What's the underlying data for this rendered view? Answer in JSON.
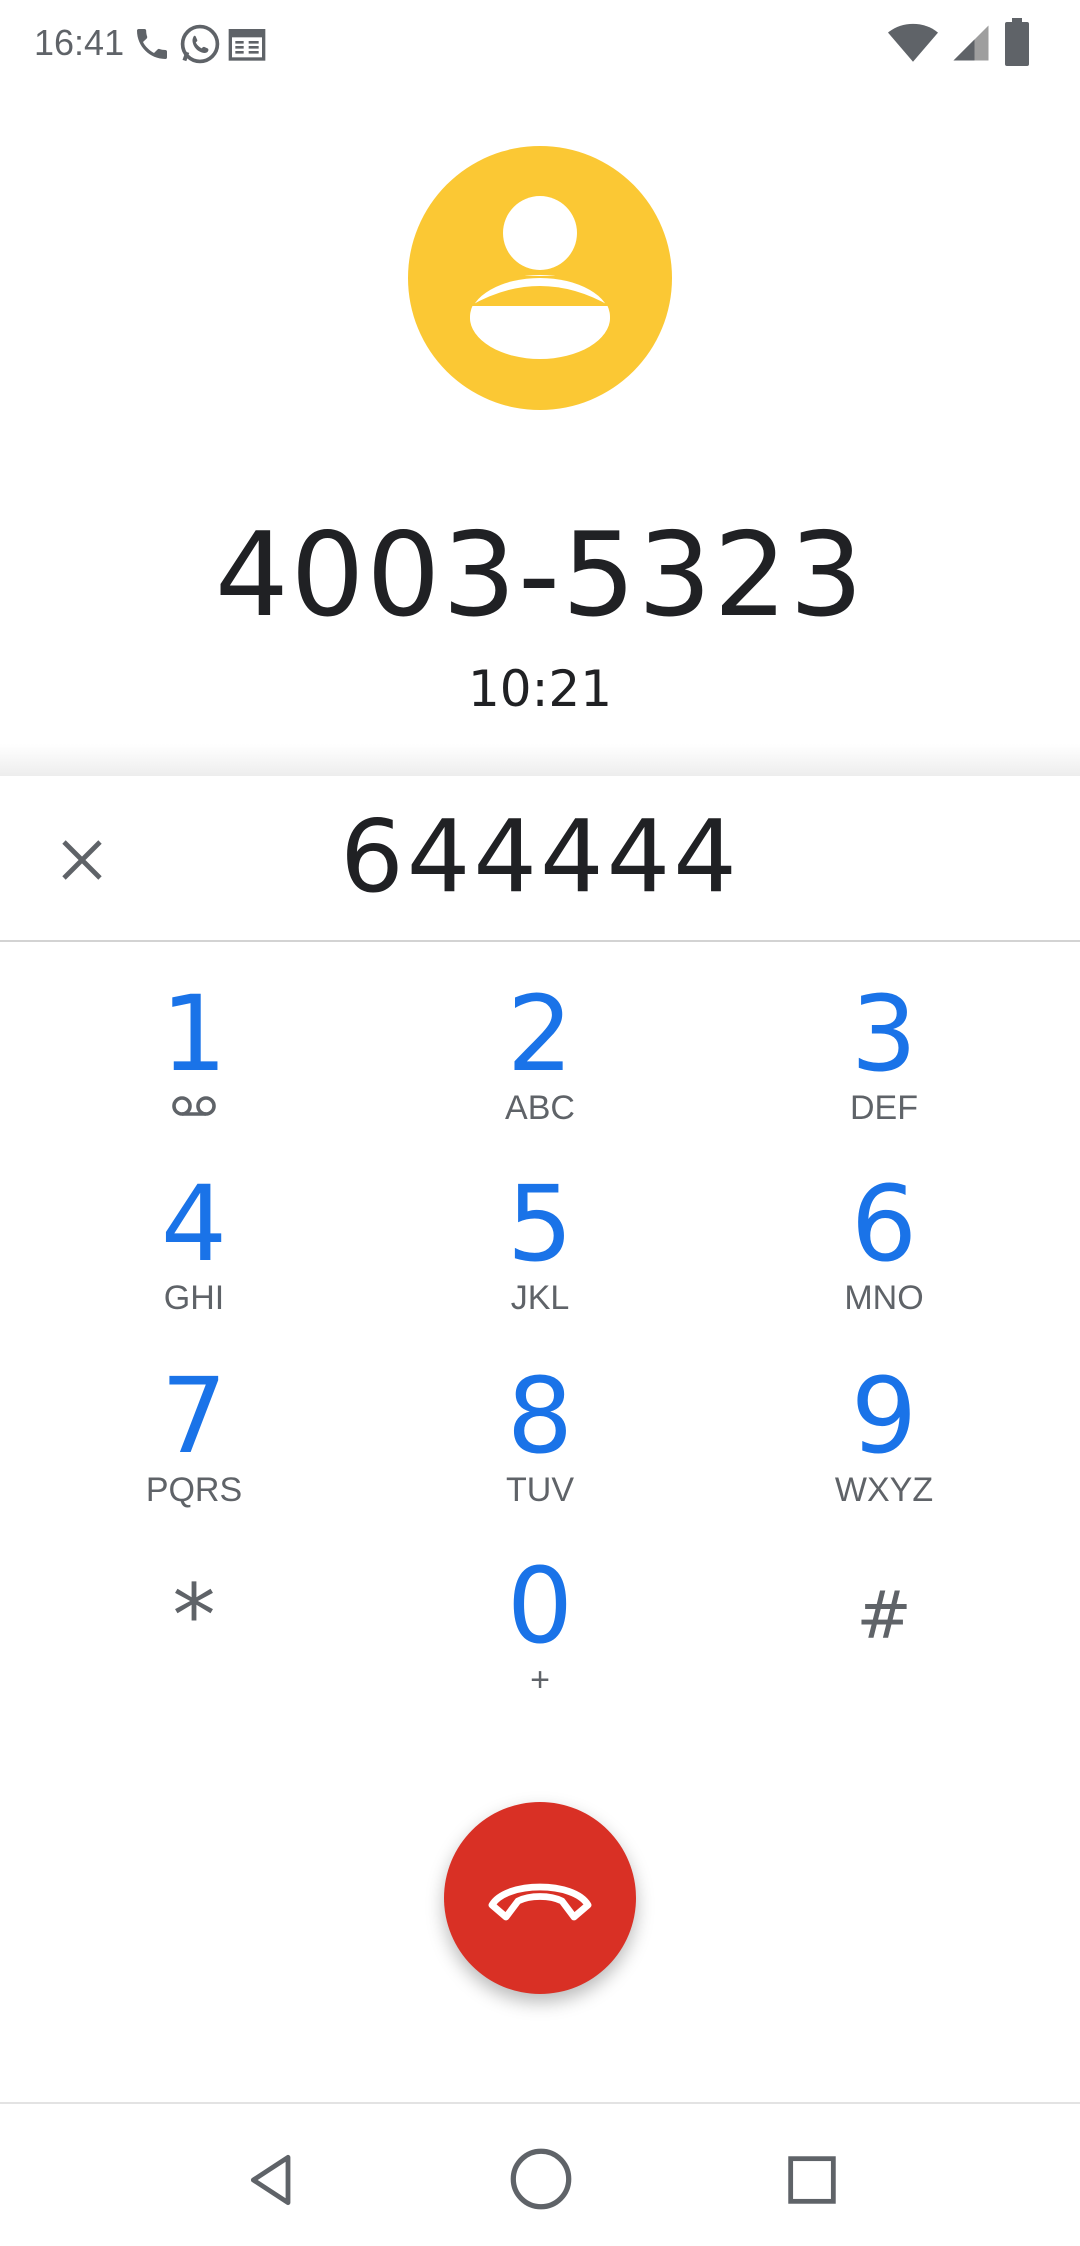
{
  "status_bar": {
    "time": "16:41",
    "left_icons": [
      "phone-icon",
      "whatsapp-icon",
      "calendar-icon"
    ],
    "right_icons": [
      "wifi-icon",
      "signal-icon",
      "battery-icon"
    ]
  },
  "call": {
    "caller_number": "4003-5323",
    "duration": "10:21",
    "avatar_icon": "person-icon",
    "avatar_color": "#fbc834"
  },
  "dialpad": {
    "entered_digits": "644444",
    "clear_icon": "close-icon",
    "keys": [
      {
        "digit": "1",
        "letters": "",
        "sub_icon": "voicemail-icon"
      },
      {
        "digit": "2",
        "letters": "ABC"
      },
      {
        "digit": "3",
        "letters": "DEF"
      },
      {
        "digit": "4",
        "letters": "GHI"
      },
      {
        "digit": "5",
        "letters": "JKL"
      },
      {
        "digit": "6",
        "letters": "MNO"
      },
      {
        "digit": "7",
        "letters": "PQRS"
      },
      {
        "digit": "8",
        "letters": "TUV"
      },
      {
        "digit": "9",
        "letters": "WXYZ"
      },
      {
        "digit": "*",
        "letters": ""
      },
      {
        "digit": "0",
        "letters": "+"
      },
      {
        "digit": "#",
        "letters": ""
      }
    ],
    "digit_color": "#1a73e8"
  },
  "end_call": {
    "icon": "hang-up-icon",
    "color": "#d93025"
  },
  "nav_bar": {
    "buttons": [
      "back-icon",
      "home-icon",
      "recents-icon"
    ]
  }
}
